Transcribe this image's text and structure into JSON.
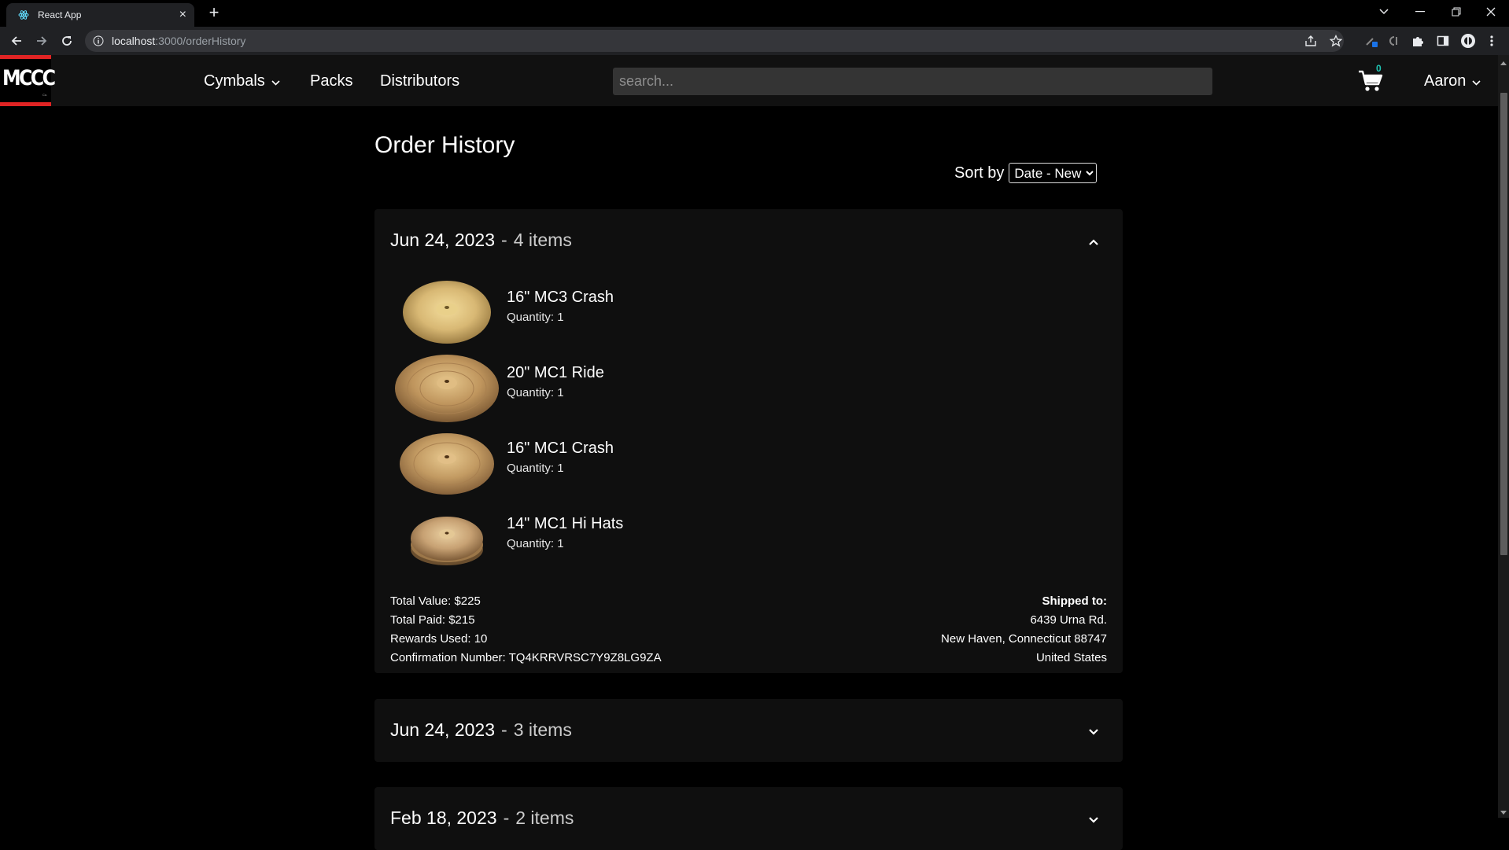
{
  "browser": {
    "tab_title": "React App",
    "url_host": "localhost",
    "url_path": ":3000/orderHistory"
  },
  "nav": {
    "logo_text": "MCCC",
    "logo_sub": "Co.",
    "links": [
      "Cymbals",
      "Packs",
      "Distributors"
    ],
    "search_placeholder": "search...",
    "cart_count": "0",
    "user_name": "Aaron"
  },
  "page": {
    "title": "Order History",
    "sort_label": "Sort by",
    "sort_value": "Date - New"
  },
  "orders": [
    {
      "date": "Jun 24, 2023",
      "separator": "-",
      "count_label": "4 items",
      "expanded": true,
      "items": [
        {
          "name": "16\" MC3 Crash",
          "quantity": "Quantity: 1",
          "icon": "crash-cymbal-image"
        },
        {
          "name": "20\" MC1 Ride",
          "quantity": "Quantity: 1",
          "icon": "ride-cymbal-image"
        },
        {
          "name": "16\" MC1 Crash",
          "quantity": "Quantity: 1",
          "icon": "crash-cymbal-image"
        },
        {
          "name": "14\" MC1 Hi Hats",
          "quantity": "Quantity: 1",
          "icon": "hihat-cymbal-image"
        }
      ],
      "total_value": "Total Value: $225",
      "total_paid": "Total Paid: $215",
      "rewards_used": "Rewards Used: 10",
      "confirmation": "Confirmation Number: TQ4KRRVRSC7Y9Z8LG9ZA",
      "shipped_to_label": "Shipped to:",
      "address_line1": "6439 Urna Rd.",
      "address_line2": "New Haven, Connecticut 88747",
      "address_country": "United States"
    },
    {
      "date": "Jun 24, 2023",
      "separator": "-",
      "count_label": "3 items",
      "expanded": false
    },
    {
      "date": "Feb 18, 2023",
      "separator": "-",
      "count_label": "2 items",
      "expanded": false
    }
  ]
}
